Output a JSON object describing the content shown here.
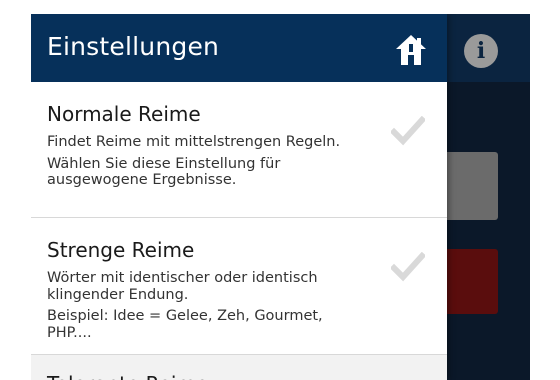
{
  "header": {
    "title": "Einstellungen",
    "home_icon": "home-icon",
    "info_icon": "info-icon",
    "info_glyph": "i"
  },
  "options": [
    {
      "title": "Normale Reime",
      "desc": [
        "Findet Reime mit mittelstrengen Regeln.",
        "Wählen Sie diese Einstellung für ausgewogene Ergebnisse."
      ],
      "selected": false
    },
    {
      "title": "Strenge Reime",
      "desc": [
        "Wörter mit identischer oder identisch klingender Endung.",
        "Beispiel: Idee = Gelee, Zeh, Gourmet, PHP...."
      ],
      "selected": false
    },
    {
      "title": "Tolerante Reime",
      "desc": [],
      "selected": true
    }
  ],
  "colors": {
    "header_bg": "#06305a",
    "check_inactive": "#d9d9d9",
    "check_active": "#6aa84f",
    "bg_red": "#5a0d0d"
  }
}
